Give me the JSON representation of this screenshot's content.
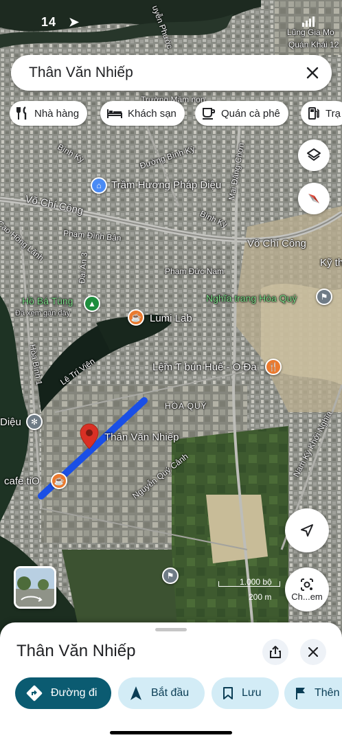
{
  "status_bar": {
    "time": "14"
  },
  "search": {
    "query": "Thân Văn Nhiếp"
  },
  "chips": [
    {
      "label": "Nhà hàng",
      "icon": "fork-knife-icon"
    },
    {
      "label": "Khách sạn",
      "icon": "bed-icon"
    },
    {
      "label": "Quán cà phê",
      "icon": "coffee-cup-icon"
    },
    {
      "label": "Trạ",
      "icon": "fuel-pump-icon"
    }
  ],
  "map": {
    "labels": {
      "street_top1": "Đường Bình Kỳ",
      "binh_ky_1": "Bình Kỳ",
      "binh_ky_2": "Bình Kỳ",
      "mai_dang_chon": "Mai Đăng Chơn",
      "vo_chi_cong_1": "Võ Chí Công",
      "vo_chi_cong_2": "Võ Chí Công",
      "pham_dinh_ban": "Phạm Đình Bân",
      "pham_duc_nam": "Phạm Đức Nam",
      "dai_an_3": "Đại An 3",
      "cao_hong_lanh": "Cao Hồng Lãnh",
      "ky_th": "Kỹ th",
      "le_tri_vien": "Lê Trí Viên",
      "hoa_binh_1": "Hòa Bình 1",
      "hoa_quy": "HÒA QUÝ",
      "nguyen_quy_canh": "Nguyễn Quý Cảnh",
      "nam_ky_khoi_nghia": "Nam Kỳ Khởi Nghĩa",
      "lung_gia_mo": "Lũng Gia Mo",
      "quan_khai_12": "Quán Khái 12",
      "truong_mam_non": "Trường Mầm non",
      "nguyen_phuoc": "uyễn Phước"
    },
    "pois": {
      "tram_huong": "Trầm Hương Pháp Diệu",
      "ho_ba_tung": "Hồ Bá Tùng",
      "ho_ba_tung_sub": "Đã xem gần đây",
      "nghia_trang": "Nghĩa trang Hòa Quý",
      "lumi_lab": "Lumi Lab",
      "bun_mam": "Lệ̃m Ƭ bún Huế - O Đa",
      "dieu": "Diệu",
      "cafe_tio": "cafe.tiO",
      "pin_label": "Thân Văn Nhiếp"
    },
    "scale": {
      "line1": "1.000 bộ",
      "line2": "200 m"
    },
    "lens_label": "Ch...em",
    "colors": {
      "route": "#1a4fe6",
      "pin": "#d93025",
      "poi_orange": "#ea7a2f",
      "poi_green": "#1e8e3e",
      "poi_blue": "#4a8bf5",
      "poi_gray": "#6f7b86"
    }
  },
  "sheet": {
    "title": "Thân Văn Nhiếp",
    "actions": [
      {
        "label": "Đường đi",
        "icon": "directions-icon"
      },
      {
        "label": "Bắt đầu",
        "icon": "navigation-arrow-icon"
      },
      {
        "label": "Lưu",
        "icon": "bookmark-icon"
      },
      {
        "label": "Thên",
        "icon": "flag-icon"
      }
    ]
  }
}
